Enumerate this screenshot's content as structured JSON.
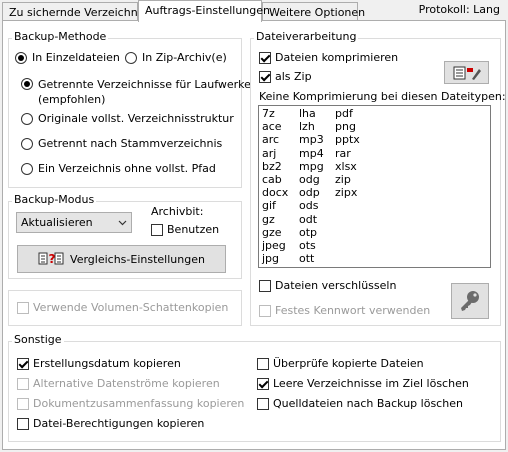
{
  "tabs": [
    {
      "label": "Zu sichernde Verzeichnisse"
    },
    {
      "label": "Auftrags-Einstellungen"
    },
    {
      "label": "Weitere Optionen"
    }
  ],
  "protocol_label": "Protokoll: Lang",
  "backup_method": {
    "title": "Backup-Methode",
    "single_files": "In Einzeldateien",
    "zip_archive": "In Zip-Archiv(e)",
    "opt1_line1": "Getrennte Verzeichnisse für Laufwerke",
    "opt1_line2": "(empfohlen)",
    "opt2": "Originale vollst. Verzeichnisstruktur",
    "opt3": "Getrennt nach Stammverzeichnis",
    "opt4": "Ein Verzeichnis ohne vollst. Pfad"
  },
  "backup_mode": {
    "title": "Backup-Modus",
    "selected": "Aktualisieren",
    "archivbit_label": "Archivbit:",
    "use_label": "Benutzen",
    "compare_button": "Vergleichs-Einstellungen"
  },
  "shadow_copy": "Verwende Volumen-Schattenkopien",
  "file_processing": {
    "title": "Dateiverarbeitung",
    "compress": "Dateien komprimieren",
    "as_zip": "als Zip",
    "no_compress_label": "Keine Komprimierung bei diesen Dateitypen:",
    "types_col1": [
      "7z",
      "ace",
      "arc",
      "arj",
      "bz2",
      "cab",
      "docx",
      "gif",
      "gz",
      "gze",
      "jpeg",
      "jpg"
    ],
    "types_col2": [
      "lha",
      "lzh",
      "mp3",
      "mp4",
      "mpg",
      "odg",
      "odp",
      "ods",
      "odt",
      "otp",
      "ots",
      "ott"
    ],
    "types_col3": [
      "pdf",
      "png",
      "pptx",
      "rar",
      "xlsx",
      "zip",
      "zipx"
    ],
    "encrypt": "Dateien verschlüsseln",
    "fixed_password": "Festes Kennwort verwenden"
  },
  "misc": {
    "title": "Sonstige",
    "creation_date": "Erstellungsdatum kopieren",
    "alt_streams": "Alternative Datenströme kopieren",
    "doc_summary": "Dokumentzusammenfassung kopieren",
    "file_permissions": "Datei-Berechtigungen kopieren",
    "verify_copied": "Überprüfe kopierte Dateien",
    "empty_dirs": "Leere Verzeichnisse im Ziel löschen",
    "delete_source": "Quelldateien nach Backup löschen"
  }
}
